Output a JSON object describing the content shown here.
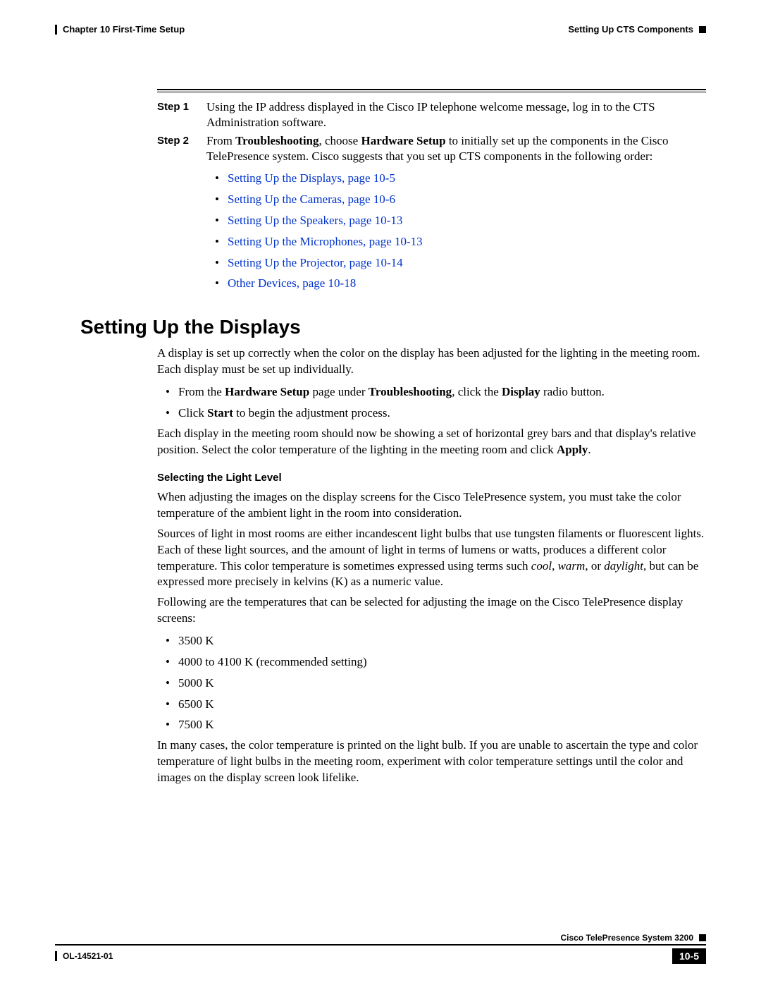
{
  "header": {
    "chapter": "Chapter 10    First-Time Setup",
    "section": "Setting Up CTS Components"
  },
  "steps": [
    {
      "label": "Step 1",
      "text_before": "Using the IP address displayed in the Cisco IP telephone welcome message, log in to the CTS Administration software.",
      "bold1": "",
      "mid1": "",
      "bold2": "",
      "after": ""
    },
    {
      "label": "Step 2",
      "text_before": "From ",
      "bold1": "Troubleshooting",
      "mid1": ", choose ",
      "bold2": "Hardware Setup",
      "after": " to initially set up the components in the Cisco TelePresence system. Cisco suggests that you set up CTS components in the following order:"
    }
  ],
  "link_list": [
    "Setting Up the Displays, page 10-5",
    "Setting Up the Cameras, page 10-6",
    "Setting Up the Speakers, page 10-13",
    "Setting Up the Microphones, page 10-13",
    "Setting Up the Projector, page 10-14",
    "Other Devices, page 10-18"
  ],
  "main": {
    "heading": "Setting Up the Displays",
    "intro": "A display is set up correctly when the color on the display has been adjusted for the lighting in the meeting room. Each display must be set up individually.",
    "bullets_hw": {
      "b1_pre": "From the ",
      "b1_b1": "Hardware Setup",
      "b1_mid": " page under ",
      "b1_b2": "Troubleshooting",
      "b1_mid2": ", click the ",
      "b1_b3": "Display",
      "b1_post": " radio button.",
      "b2_pre": "Click ",
      "b2_b1": "Start",
      "b2_post": " to begin the adjustment process."
    },
    "para2_pre": "Each display in the meeting room should now be showing a set of horizontal grey bars and that display's relative position. Select the color temperature of the lighting in the meeting room and click ",
    "para2_bold": "Apply",
    "para2_post": ".",
    "subheading": "Selecting the Light Level",
    "light_p1": "When adjusting the images on the display screens for the Cisco TelePresence system, you must take the color temperature of the ambient light in the room into consideration.",
    "light_p2_pre": "Sources of light in most rooms are either incandescent light bulbs that use tungsten filaments or fluorescent lights. Each of these light sources, and the amount of light in terms of lumens or watts, produces a different color temperature. This color temperature is sometimes expressed using terms such ",
    "light_p2_i1": "cool",
    "light_p2_m1": ", ",
    "light_p2_i2": "warm",
    "light_p2_m2": ", or ",
    "light_p2_i3": "daylight",
    "light_p2_post": ", but can be expressed more precisely in kelvins (K) as a numeric value.",
    "light_p3": "Following are the temperatures that can be selected for adjusting the image on the Cisco TelePresence display screens:",
    "temps": [
      "3500 K",
      "4000 to 4100 K (recommended setting)",
      "5000 K",
      "6500 K",
      "7500 K"
    ],
    "light_p4": "In many cases, the color temperature is printed on the light bulb. If you are unable to ascertain the type and color temperature of light bulbs in the meeting room, experiment with color temperature settings until the color and images on the display screen look lifelike."
  },
  "footer": {
    "product": "Cisco TelePresence System 3200",
    "docid": "OL-14521-01",
    "pagenum": "10-5"
  }
}
